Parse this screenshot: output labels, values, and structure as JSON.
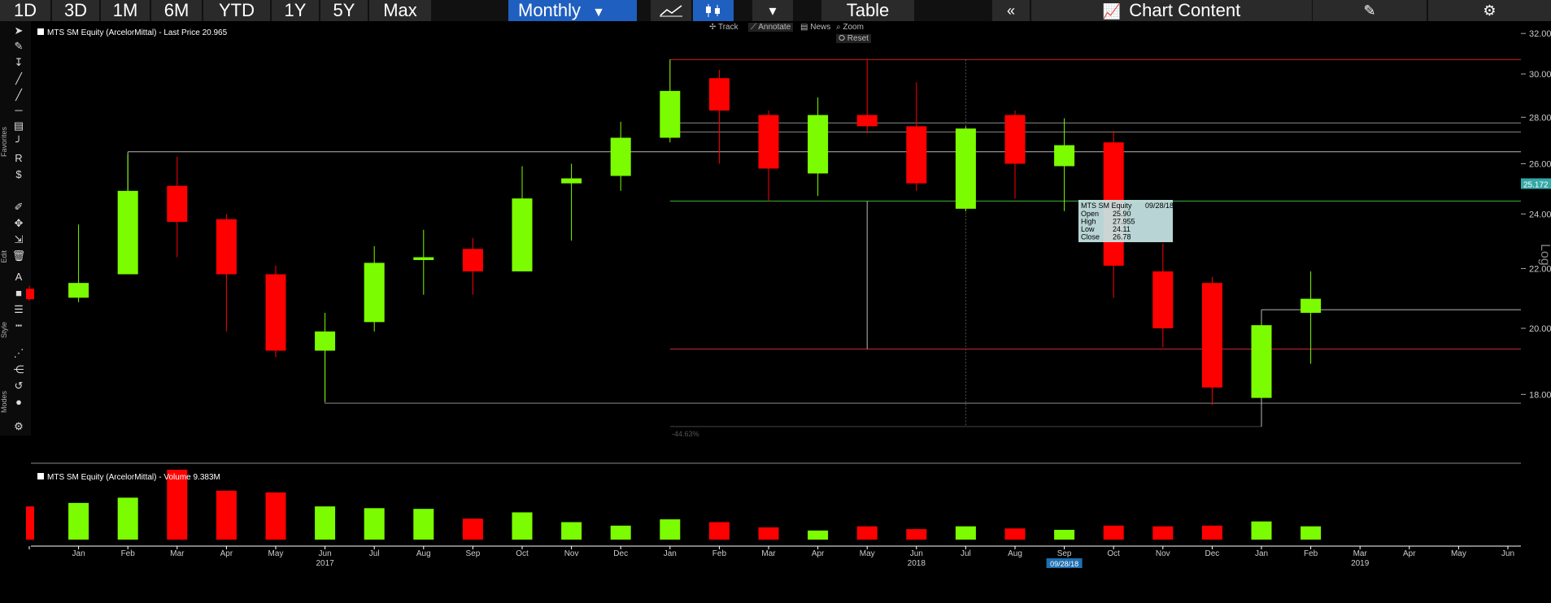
{
  "toolbar": {
    "ranges": [
      "1D",
      "3D",
      "1M",
      "6M",
      "YTD",
      "1Y",
      "5Y",
      "Max"
    ],
    "period": "Monthly",
    "table_label": "Table",
    "chart_content_label": "Chart Content"
  },
  "chart_controls": [
    "Track",
    "Annotate",
    "News",
    "Zoom"
  ],
  "reset_label": "Reset",
  "left_panel_labels": [
    "Favorites",
    "Edit",
    "Style",
    "Modes"
  ],
  "chart_data": {
    "type": "candlestick",
    "price_legend": "MTS SM Equity (ArcelorMittal) - Last Price 20.965",
    "volume_legend": "MTS SM Equity (ArcelorMittal) - Volume 9.383M",
    "scale_label": "Log",
    "last_price_tag": "25.172",
    "y_ticks": [
      "18.00",
      "20.00",
      "22.00",
      "24.00",
      "26.00",
      "28.00",
      "30.00",
      "32.00"
    ],
    "ylim": [
      16.9,
      32.3
    ],
    "months": [
      "Dec",
      "Jan",
      "Feb",
      "Mar",
      "Apr",
      "May",
      "Jun",
      "Jul",
      "Aug",
      "Sep",
      "Oct",
      "Nov",
      "Dec",
      "Jan",
      "Feb",
      "Mar",
      "Apr",
      "May",
      "Jun",
      "Jul",
      "Aug",
      "Sep",
      "Oct",
      "Nov",
      "Dec",
      "Jan",
      "Feb",
      "Mar",
      "Apr",
      "May",
      "Jun"
    ],
    "month_labels_shown": [
      false,
      true,
      true,
      true,
      true,
      true,
      true,
      true,
      true,
      true,
      true,
      true,
      true,
      true,
      true,
      true,
      true,
      true,
      true,
      true,
      true,
      true,
      true,
      true,
      true,
      true,
      true,
      true,
      true,
      true,
      true
    ],
    "year_labels": [
      {
        "index": 6,
        "text": "2017"
      },
      {
        "index": 18,
        "text": "2018"
      },
      {
        "index": 27,
        "text": "2019"
      }
    ],
    "highlight_label": {
      "index": 21,
      "text": "09/28/18"
    },
    "candles": [
      {
        "o": 21.3,
        "h": 21.4,
        "l": 20.9,
        "c": 20.95
      },
      {
        "o": 21.0,
        "h": 23.6,
        "l": 20.85,
        "c": 21.5
      },
      {
        "o": 21.8,
        "h": 26.4,
        "l": 21.8,
        "c": 24.9
      },
      {
        "o": 25.1,
        "h": 26.3,
        "l": 22.4,
        "c": 23.7
      },
      {
        "o": 23.8,
        "h": 24.0,
        "l": 19.9,
        "c": 21.8
      },
      {
        "o": 21.8,
        "h": 22.1,
        "l": 19.1,
        "c": 19.3
      },
      {
        "o": 19.3,
        "h": 20.5,
        "l": 17.8,
        "c": 19.9
      },
      {
        "o": 20.2,
        "h": 22.8,
        "l": 19.9,
        "c": 22.2
      },
      {
        "o": 22.3,
        "h": 23.4,
        "l": 21.1,
        "c": 22.4
      },
      {
        "o": 22.7,
        "h": 23.1,
        "l": 21.1,
        "c": 21.9
      },
      {
        "o": 21.9,
        "h": 25.9,
        "l": 21.9,
        "c": 24.6
      },
      {
        "o": 25.2,
        "h": 26.0,
        "l": 23.0,
        "c": 25.4
      },
      {
        "o": 25.5,
        "h": 27.8,
        "l": 24.9,
        "c": 27.1
      },
      {
        "o": 27.1,
        "h": 30.7,
        "l": 26.9,
        "c": 29.2
      },
      {
        "o": 29.8,
        "h": 30.2,
        "l": 26.0,
        "c": 28.3
      },
      {
        "o": 28.1,
        "h": 28.3,
        "l": 24.5,
        "c": 25.8
      },
      {
        "o": 25.6,
        "h": 28.9,
        "l": 24.7,
        "c": 28.1
      },
      {
        "o": 28.1,
        "h": 30.7,
        "l": 27.3,
        "c": 27.6
      },
      {
        "o": 27.6,
        "h": 29.6,
        "l": 24.9,
        "c": 25.2
      },
      {
        "o": 24.2,
        "h": 27.6,
        "l": 24.1,
        "c": 27.5
      },
      {
        "o": 28.1,
        "h": 28.3,
        "l": 24.6,
        "c": 26.0
      },
      {
        "o": 25.9,
        "h": 27.955,
        "l": 24.11,
        "c": 26.78
      },
      {
        "o": 26.9,
        "h": 27.4,
        "l": 21.0,
        "c": 22.1
      },
      {
        "o": 21.9,
        "h": 22.9,
        "l": 19.4,
        "c": 20.0
      },
      {
        "o": 21.5,
        "h": 21.7,
        "l": 17.7,
        "c": 18.2
      },
      {
        "o": 17.9,
        "h": 20.2,
        "l": 17.9,
        "c": 20.1
      },
      {
        "o": 20.5,
        "h": 21.9,
        "l": 18.9,
        "c": 20.965
      }
    ],
    "volume_max": 20,
    "volumes": [
      9.5,
      10.5,
      12.0,
      21.0,
      14.0,
      13.5,
      9.5,
      9.0,
      8.8,
      6.0,
      7.8,
      5.0,
      4.0,
      5.8,
      5.0,
      3.5,
      2.6,
      3.8,
      3.0,
      3.8,
      3.2,
      2.8,
      4.0,
      3.8,
      4.0,
      5.2,
      3.8
    ],
    "horizontal_lines": [
      {
        "y": 30.7,
        "color": "#c8282a"
      },
      {
        "y": 27.75,
        "color": "#8a8a8a"
      },
      {
        "y": 27.35,
        "color": "#8a8a8a"
      },
      {
        "y": 26.5,
        "color": "#b8b8b8"
      },
      {
        "y": 24.5,
        "color": "#3bb53b"
      },
      {
        "y": 19.35,
        "color": "#c8282a"
      },
      {
        "y": 17.75,
        "color": "#8a8a8a"
      },
      {
        "y": 20.6,
        "color": "#b8b8b8"
      }
    ],
    "percent_label": "-44.63%",
    "tooltip": {
      "title": "MTS SM Equity",
      "date": "09/28/18",
      "rows": [
        {
          "label": "Open",
          "value": "25.90"
        },
        {
          "label": "High",
          "value": "27.955"
        },
        {
          "label": "Low",
          "value": "24.11"
        },
        {
          "label": "Close",
          "value": "26.78"
        }
      ]
    },
    "colors": {
      "up": "#7cfc00",
      "down": "#ff0000",
      "background": "#000000",
      "axis": "#ffffff"
    }
  }
}
